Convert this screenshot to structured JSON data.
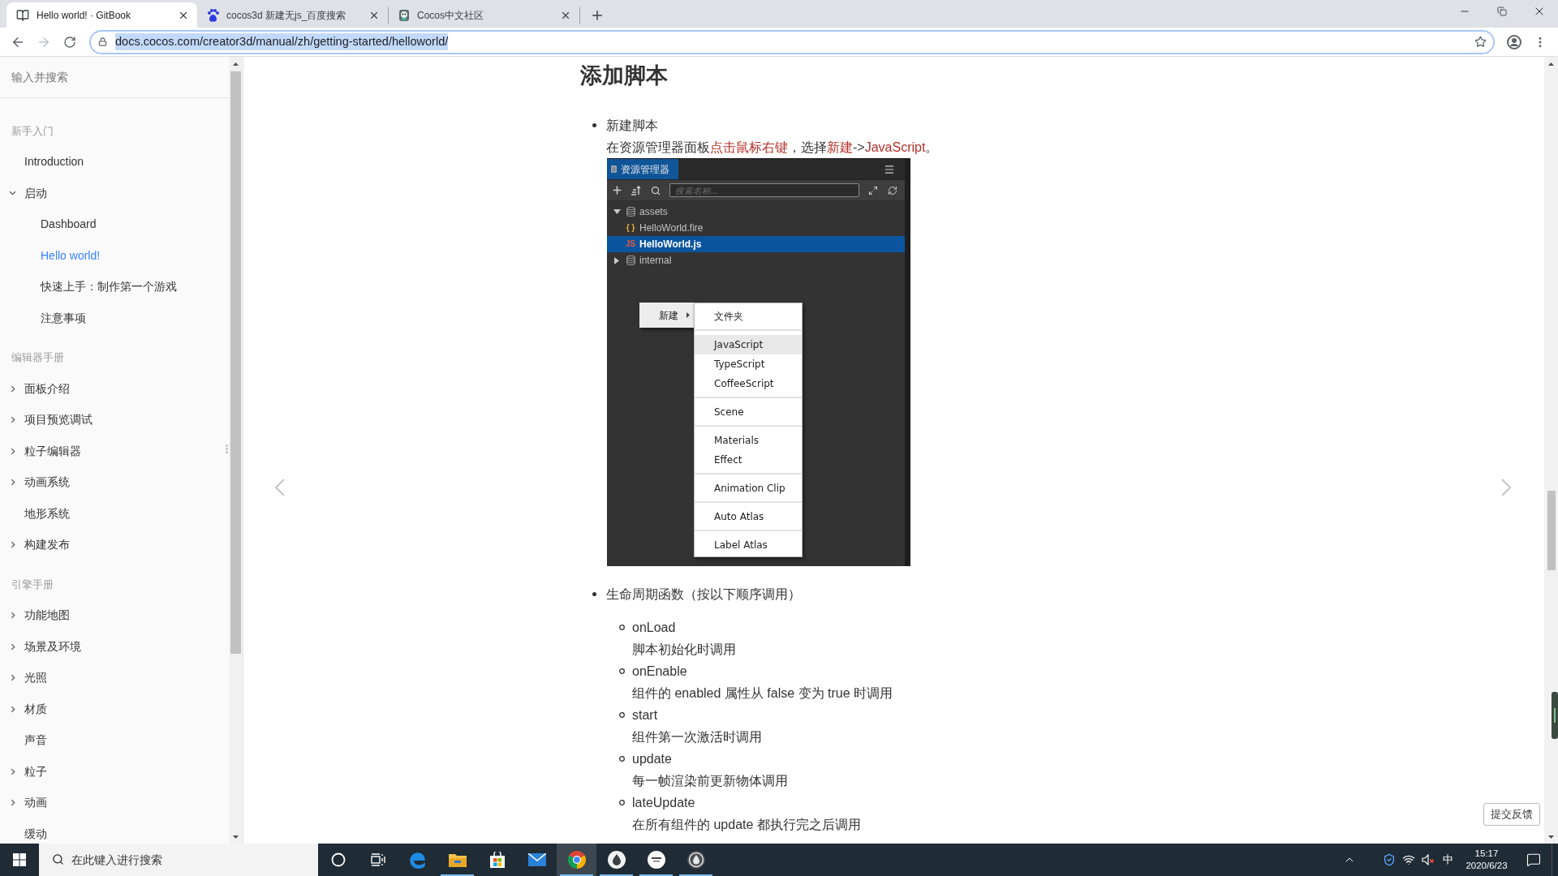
{
  "browser": {
    "tabs": [
      {
        "title": "Hello world! · GitBook",
        "selected": true,
        "kind": "book"
      },
      {
        "title": "cocos3d 新建无js_百度搜索",
        "selected": false,
        "kind": "paw"
      },
      {
        "title": "Cocos中文社区",
        "selected": false,
        "kind": "mascot"
      }
    ],
    "forward_disabled": true,
    "address_bar": {
      "url": "docs.cocos.com/creator3d/manual/zh/getting-started/helloworld/",
      "url_selected": true
    }
  },
  "sidebar": {
    "search": {
      "placeholder": "输入并搜索"
    },
    "sections": [
      {
        "header": "新手入门",
        "items": [
          {
            "label": "Introduction",
            "selected": false
          },
          {
            "label": "启动",
            "selected": false,
            "expanded": true,
            "children": [
              {
                "label": "Dashboard",
                "selected": false
              },
              {
                "label": "Hello world!",
                "selected": true
              },
              {
                "label": "快速上手：制作第一个游戏",
                "selected": false
              },
              {
                "label": "注意事项",
                "selected": false
              }
            ]
          }
        ]
      },
      {
        "header": "编辑器手册",
        "items": [
          {
            "label": "面板介绍",
            "selected": false,
            "expanded": false
          },
          {
            "label": "项目预览调试",
            "selected": false,
            "expanded": false
          },
          {
            "label": "粒子编辑器",
            "selected": false,
            "expanded": false
          },
          {
            "label": "动画系统",
            "selected": false,
            "expanded": false
          },
          {
            "label": "地形系统",
            "selected": false
          },
          {
            "label": "构建发布",
            "selected": false,
            "expanded": false
          }
        ]
      },
      {
        "header": "引擎手册",
        "items": [
          {
            "label": "功能地图",
            "selected": false,
            "expanded": false
          },
          {
            "label": "场景及环境",
            "selected": false,
            "expanded": false
          },
          {
            "label": "光照",
            "selected": false,
            "expanded": false
          },
          {
            "label": "材质",
            "selected": false,
            "expanded": false
          },
          {
            "label": "声音",
            "selected": false
          },
          {
            "label": "粒子",
            "selected": false,
            "expanded": false
          },
          {
            "label": "动画",
            "selected": false,
            "expanded": false
          },
          {
            "label": "缓动",
            "selected": false
          }
        ]
      }
    ]
  },
  "article": {
    "heading": "添加脚本",
    "bullets": [
      {
        "title": "新建脚本",
        "body": [
          {
            "text": "在资源管理器面板",
            "highlight": false
          },
          {
            "text": "点击鼠标右键",
            "highlight": true
          },
          {
            "text": "，选择",
            "highlight": false
          },
          {
            "text": "新建",
            "highlight": true
          },
          {
            "text": "->",
            "highlight": false
          },
          {
            "text": "JavaScript",
            "highlight": true
          },
          {
            "text": "。",
            "highlight": false
          }
        ],
        "figure": {
          "panel_title": "资源管理器",
          "search_placeholder": "搜索名称...",
          "tree": [
            {
              "label": "assets",
              "kind": "folder",
              "selected": false,
              "expanded": true,
              "children": [
                {
                  "label": "HelloWorld.fire",
                  "kind": "file",
                  "glyph": "{ }",
                  "color": "#e8b040",
                  "selected": false
                },
                {
                  "label": "HelloWorld.js",
                  "kind": "file",
                  "glyph": "JS",
                  "color": "#e8583c",
                  "selected": true
                }
              ]
            },
            {
              "label": "internal",
              "kind": "folder",
              "selected": false,
              "expanded": false
            }
          ],
          "context_menu": [
            {
              "label": "新建",
              "selected": true,
              "submenu": [
                [
                  {
                    "label": "文件夹",
                    "selected": false
                  }
                ],
                [
                  {
                    "label": "JavaScript",
                    "selected": true
                  },
                  {
                    "label": "TypeScript",
                    "selected": false
                  },
                  {
                    "label": "CoffeeScript",
                    "selected": false
                  }
                ],
                [
                  {
                    "label": "Scene",
                    "selected": false
                  }
                ],
                [
                  {
                    "label": "Materials",
                    "selected": false
                  },
                  {
                    "label": "Effect",
                    "selected": false
                  }
                ],
                [
                  {
                    "label": "Animation Clip",
                    "selected": false
                  }
                ],
                [
                  {
                    "label": "Auto Atlas",
                    "selected": false
                  }
                ],
                [
                  {
                    "label": "Label Atlas",
                    "selected": false
                  }
                ]
              ]
            }
          ]
        }
      },
      {
        "title": "生命周期函数（按以下顺序调用）",
        "callbacks": [
          {
            "name": "onLoad",
            "description": "脚本初始化时调用"
          },
          {
            "name": "onEnable",
            "description": "组件的 enabled 属性从 false 变为 true 时调用"
          },
          {
            "name": "start",
            "description": "组件第一次激活时调用"
          },
          {
            "name": "update",
            "description": "每一帧渲染前更新物体调用"
          },
          {
            "name": "lateUpdate",
            "description": "在所有组件的 update 都执行完之后调用"
          }
        ]
      }
    ]
  },
  "feedback_button": "提交反馈",
  "taskbar": {
    "search": {
      "placeholder": "在此键入进行搜索"
    },
    "apps": [
      {
        "kind": "cortana",
        "selected": false,
        "running": false
      },
      {
        "kind": "task-view",
        "selected": false,
        "running": false
      },
      {
        "kind": "edge",
        "selected": false,
        "running": false
      },
      {
        "kind": "explorer",
        "selected": false,
        "running": true
      },
      {
        "kind": "store",
        "selected": false,
        "running": false
      },
      {
        "kind": "mail",
        "selected": false,
        "running": false
      },
      {
        "kind": "chrome",
        "selected": true,
        "running": true
      },
      {
        "kind": "drop-light",
        "selected": false,
        "running": true
      },
      {
        "kind": "badge",
        "selected": false,
        "running": true
      },
      {
        "kind": "drop-dark",
        "selected": false,
        "running": true
      }
    ],
    "tray": {
      "ime": "中",
      "time": "15:17",
      "date": "2020/6/23"
    }
  }
}
